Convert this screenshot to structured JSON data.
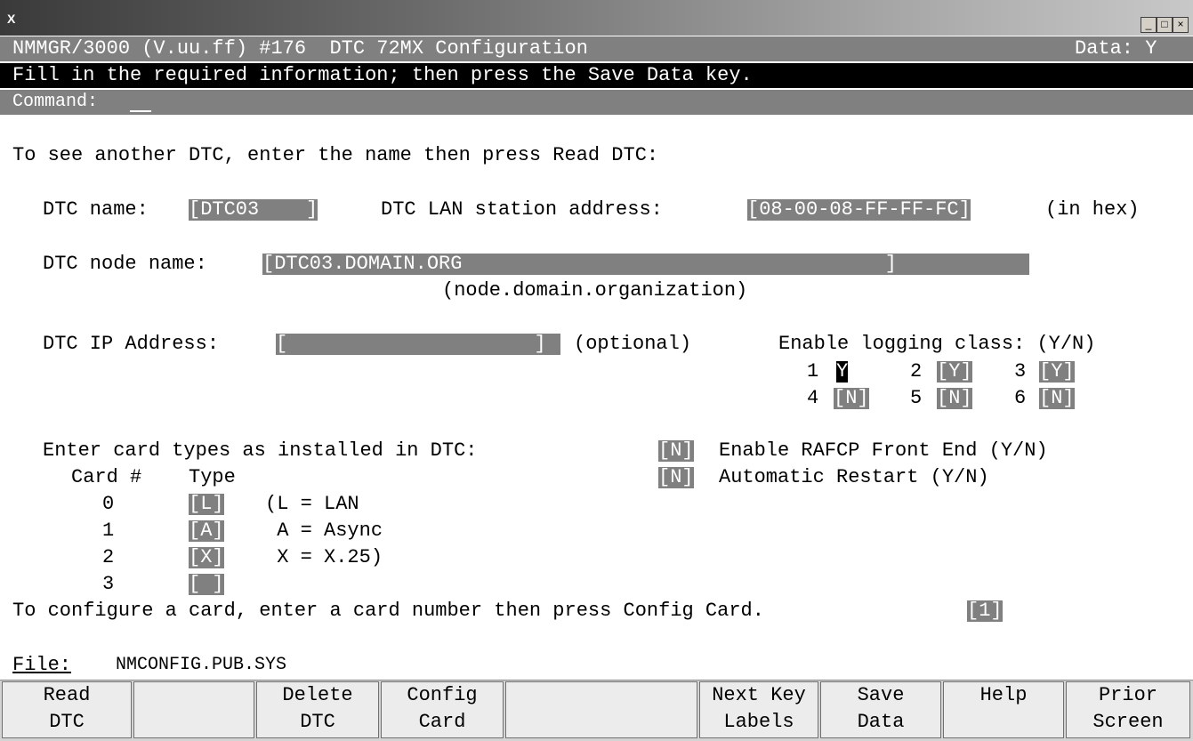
{
  "window": {
    "icon": "X",
    "controls": [
      "minimize-icon",
      "maximize-icon",
      "close-icon"
    ]
  },
  "header": {
    "title": "NMMGR/3000 (V.uu.ff) #176  DTC 72MX Configuration",
    "data_flag": "Data: Y",
    "instruction": "Fill in the required information; then press the Save Data key.",
    "command_label": "Command:"
  },
  "body": {
    "intro": "To see another DTC, enter the name then press Read DTC:",
    "dtc_name_label": "DTC name:",
    "dtc_name_value": "[DTC03    ]",
    "lan_addr_label": "DTC LAN station address:",
    "lan_addr_value": "[08-00-08-FF-FF-FC]",
    "lan_addr_suffix": "(in hex)",
    "node_name_label": "DTC node name:",
    "node_name_value": "[DTC03.DOMAIN.ORG                                    ]",
    "node_name_hint": "(node.domain.organization)",
    "ip_label": "DTC IP Address:",
    "ip_value": "[                     ]",
    "ip_suffix": "(optional)",
    "logging_label": "Enable logging class: (Y/N)",
    "logging": [
      {
        "num": "1",
        "value": "Y"
      },
      {
        "num": "2",
        "value": "[Y]"
      },
      {
        "num": "3",
        "value": "[Y]"
      },
      {
        "num": "4",
        "value": "[N]"
      },
      {
        "num": "5",
        "value": "[N]"
      },
      {
        "num": "6",
        "value": "[N]"
      }
    ],
    "card_intro": "Enter card types as installed in DTC:",
    "card_header_num": "Card #",
    "card_header_type": "Type",
    "cards": [
      {
        "num": "0",
        "type": "[L]",
        "legend": "(L = LAN"
      },
      {
        "num": "1",
        "type": "[A]",
        "legend": " A = Async"
      },
      {
        "num": "2",
        "type": "[X]",
        "legend": " X = X.25)"
      },
      {
        "num": "3",
        "type": "[ ]",
        "legend": ""
      }
    ],
    "rafcp_value": "[N]",
    "rafcp_label": "Enable RAFCP Front End (Y/N)",
    "restart_value": "[N]",
    "restart_label": "Automatic Restart (Y/N)",
    "config_prompt": "To configure a card, enter a card number then press Config Card.",
    "config_value": "[1]",
    "file_label": "File:",
    "file_value": "NMCONFIG.PUB.SYS"
  },
  "fkeys": [
    {
      "l1": "Read",
      "l2": "DTC"
    },
    {
      "l1": "",
      "l2": ""
    },
    {
      "l1": "Delete",
      "l2": "DTC"
    },
    {
      "l1": "Config",
      "l2": "Card"
    },
    {
      "l1": "",
      "l2": ""
    },
    {
      "l1": "Next Key",
      "l2": "Labels"
    },
    {
      "l1": "Save",
      "l2": "Data"
    },
    {
      "l1": "Help",
      "l2": ""
    },
    {
      "l1": "Prior",
      "l2": "Screen"
    }
  ],
  "colors": {
    "field_bg": "#808080",
    "field_fg": "#ffffff",
    "header_bg": "#808080",
    "prompt_bg": "#000000"
  }
}
